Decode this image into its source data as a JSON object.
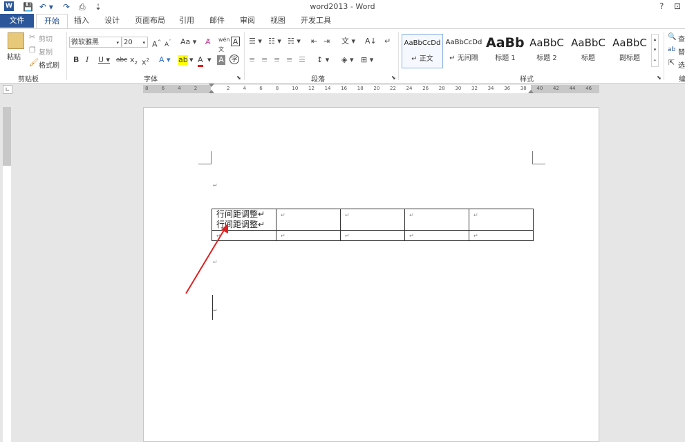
{
  "window": {
    "title": "word2013 - Word",
    "help": "?",
    "restore": "⊡"
  },
  "quick_access": {
    "save": "💾",
    "undo": "↶ ▾",
    "redo": "↷",
    "preview": "⎙",
    "customize": "⇣"
  },
  "tabs": [
    {
      "label": "文件"
    },
    {
      "label": "开始"
    },
    {
      "label": "插入"
    },
    {
      "label": "设计"
    },
    {
      "label": "页面布局"
    },
    {
      "label": "引用"
    },
    {
      "label": "邮件"
    },
    {
      "label": "审阅"
    },
    {
      "label": "视图"
    },
    {
      "label": "开发工具"
    }
  ],
  "clipboard": {
    "paste": "粘贴",
    "cut": "剪切",
    "copy": "复制",
    "format_painter": "格式刷",
    "label": "剪贴板"
  },
  "font": {
    "name": "微软雅黑",
    "size": "20",
    "label": "字体"
  },
  "paragraph": {
    "label": "段落"
  },
  "styles": {
    "label": "样式",
    "items": [
      {
        "preview": "AaBbCcDd",
        "name": "↵ 正文"
      },
      {
        "preview": "AaBbCcDd",
        "name": "↵ 无间隔"
      },
      {
        "preview": "AaBb",
        "name": "标题 1"
      },
      {
        "preview": "AaBbC",
        "name": "标题 2"
      },
      {
        "preview": "AaBbC",
        "name": "标题"
      },
      {
        "preview": "AaBbC",
        "name": "副标题"
      }
    ]
  },
  "editing": {
    "find": "查",
    "replace": "替",
    "select": "选",
    "label": "编"
  },
  "ruler": {
    "ticks": [
      "8",
      "6",
      "4",
      "2",
      "",
      "2",
      "4",
      "6",
      "8",
      "10",
      "12",
      "14",
      "16",
      "18",
      "20",
      "22",
      "24",
      "26",
      "28",
      "30",
      "32",
      "34",
      "36",
      "38",
      "40",
      "42",
      "44",
      "46"
    ]
  },
  "document": {
    "cell_line1": "行间距调整↵",
    "cell_line2": "行间距调整↵",
    "para_mark": "↵"
  },
  "colors": {
    "accent": "#2b579a",
    "arrow": "#e02020"
  }
}
